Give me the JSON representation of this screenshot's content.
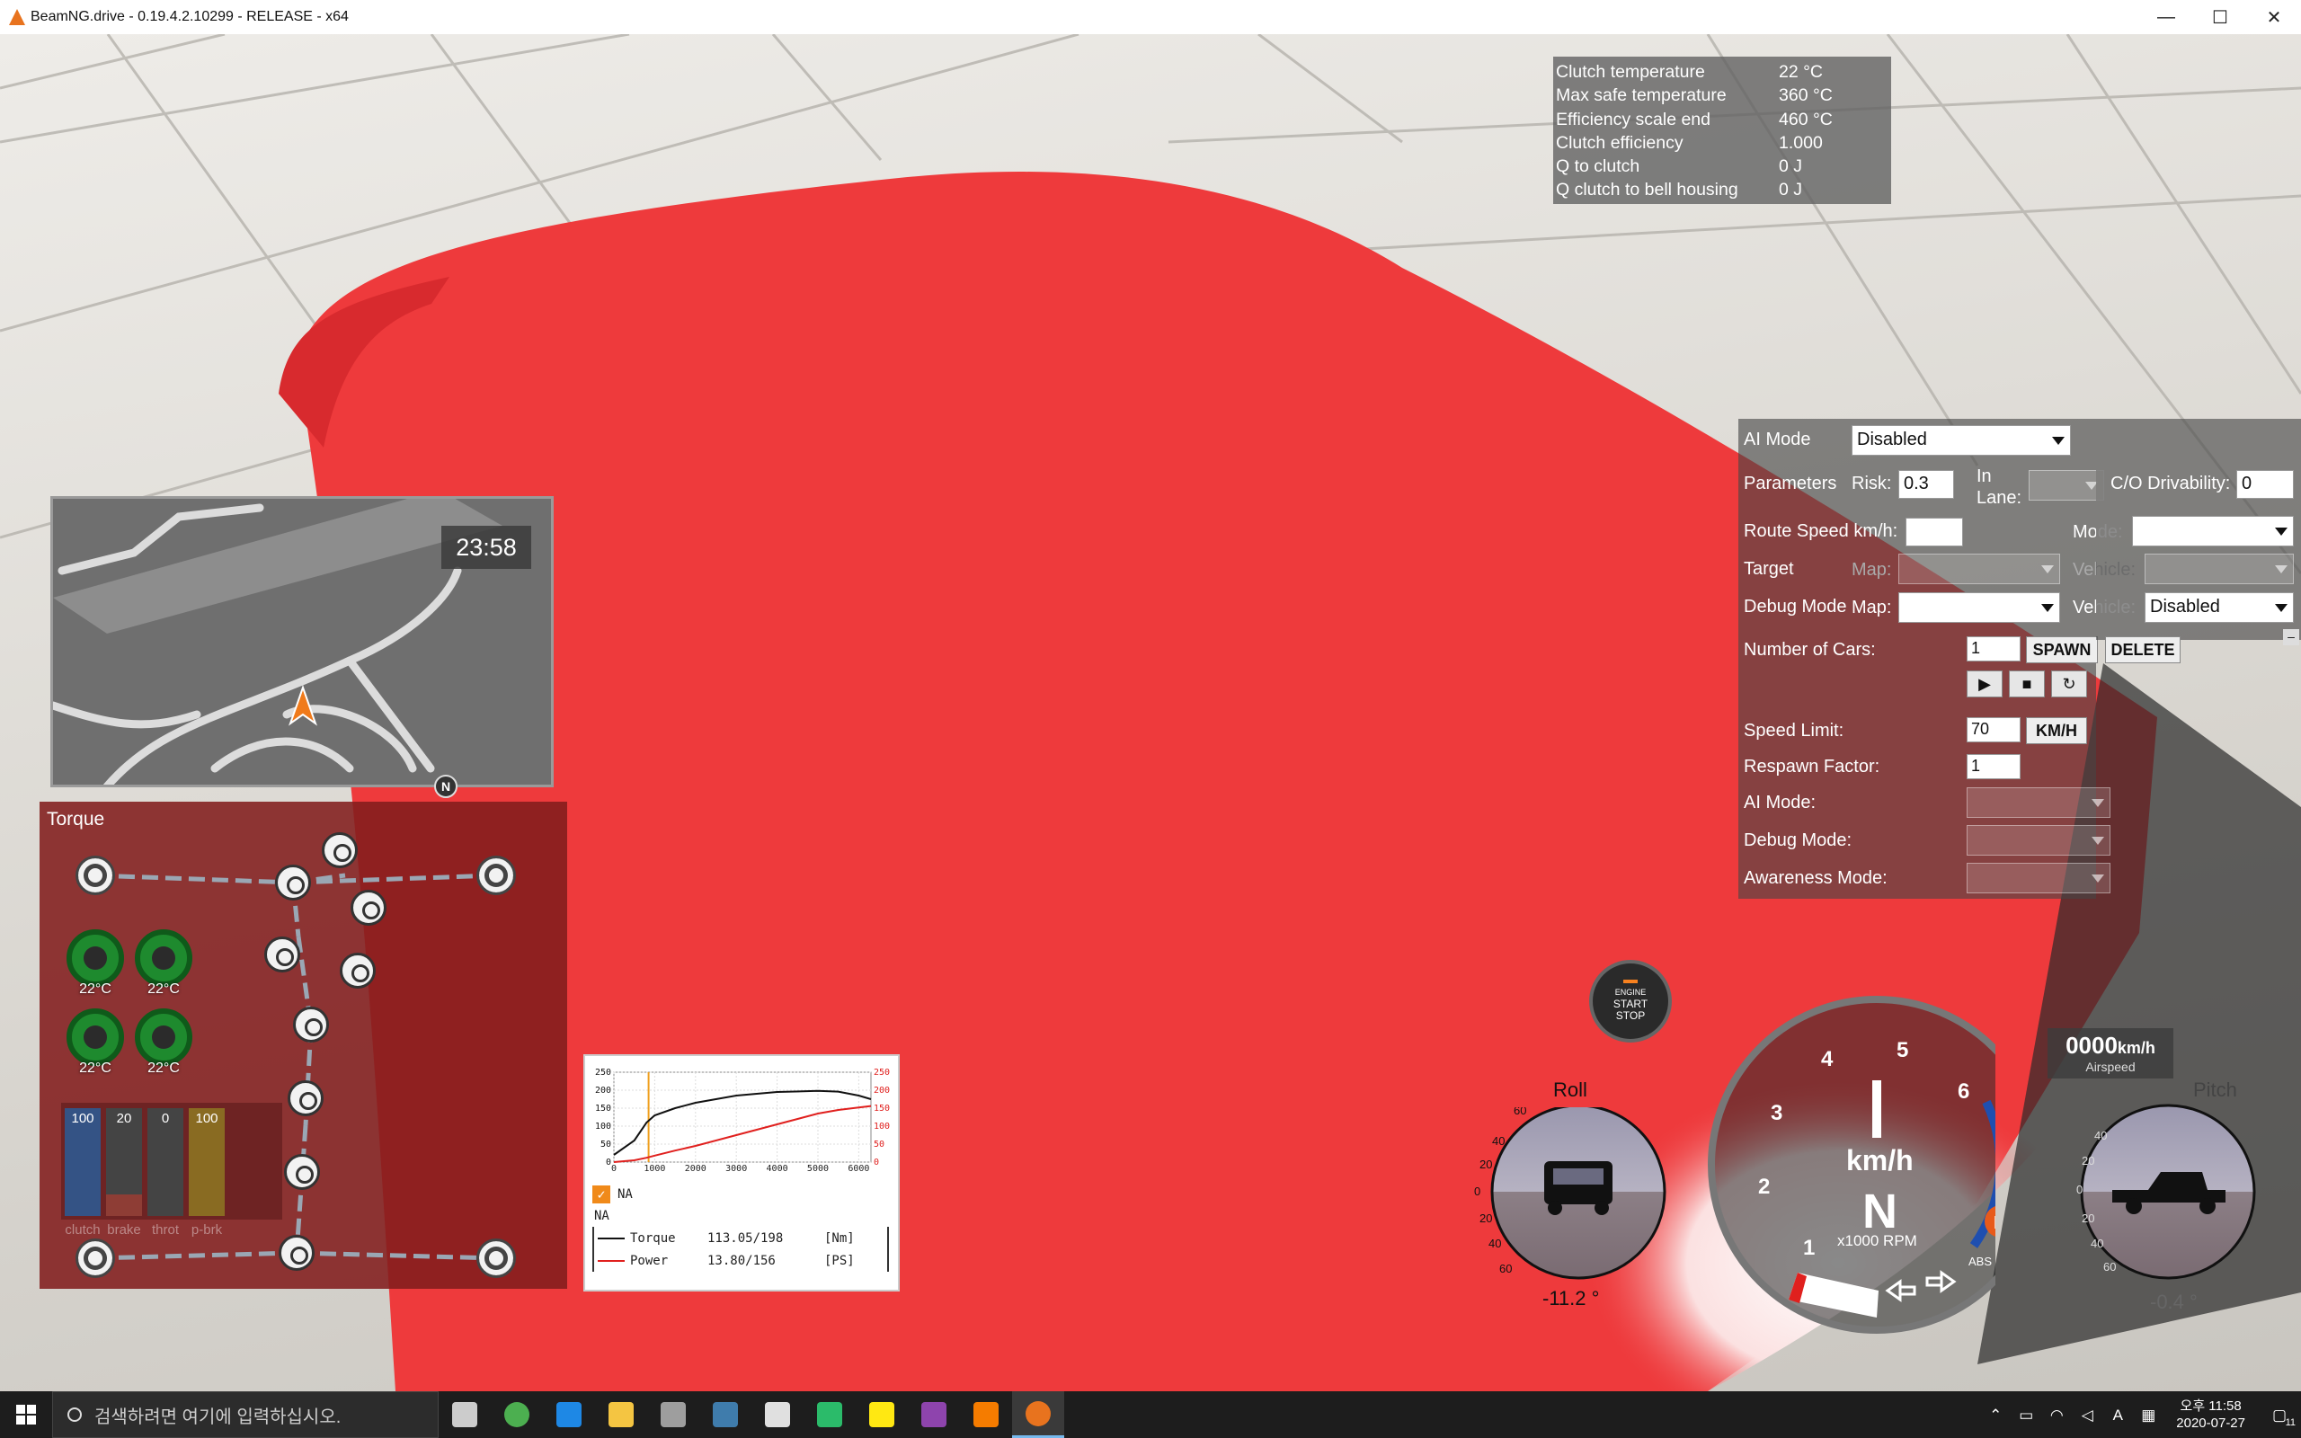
{
  "window": {
    "title": "BeamNG.drive - 0.19.4.2.10299 - RELEASE - x64",
    "minimize": "—",
    "maximize": "☐",
    "close": "✕"
  },
  "clutch_info": [
    {
      "label": "Clutch temperature",
      "value": "22 °C"
    },
    {
      "label": "Max safe temperature",
      "value": "360 °C"
    },
    {
      "label": "Efficiency scale end",
      "value": "460 °C"
    },
    {
      "label": "Clutch efficiency",
      "value": "1.000"
    },
    {
      "label": "Q to clutch",
      "value": "0 J"
    },
    {
      "label": "Q clutch to bell housing",
      "value": "0 J"
    }
  ],
  "minimap": {
    "time": "23:58",
    "compass": "N"
  },
  "torque_panel": {
    "title": "Torque",
    "brake_temps": [
      "22°C",
      "22°C",
      "22°C",
      "22°C"
    ],
    "inputs": [
      {
        "label": "clutch",
        "value": "100",
        "level": 1.0,
        "color": "#2a5db0"
      },
      {
        "label": "brake",
        "value": "20",
        "level": 0.2,
        "color": "#c0392b"
      },
      {
        "label": "throt",
        "value": "0",
        "level": 0.0,
        "color": "#27ae60"
      },
      {
        "label": "p-brk",
        "value": "100",
        "level": 1.0,
        "color": "#b8860b"
      }
    ]
  },
  "torque_graph": {
    "legend_title": "NA",
    "group_label": "NA",
    "checkbox": "✓",
    "torque_label": "Torque",
    "torque_value": "113.05/198",
    "torque_unit": "[Nm]",
    "power_label": "Power",
    "power_value": "13.80/156",
    "power_unit": "[PS]"
  },
  "chart_data": {
    "type": "line",
    "x_ticks": [
      "0",
      "1000",
      "2000",
      "3000",
      "4000",
      "5000",
      "6000"
    ],
    "y_left_ticks": [
      "250",
      "200",
      "150",
      "100",
      "50",
      "0"
    ],
    "y_right_ticks": [
      "250",
      "200",
      "150",
      "100",
      "50",
      "0"
    ],
    "xlim": [
      0,
      6300
    ],
    "ylim": [
      0,
      250
    ],
    "marker_rpm": 850,
    "series": [
      {
        "name": "Torque",
        "color": "#111111",
        "x": [
          0,
          500,
          800,
          1000,
          1500,
          2000,
          3000,
          4000,
          5000,
          5500,
          6000,
          6300
        ],
        "y": [
          20,
          60,
          110,
          130,
          150,
          165,
          185,
          195,
          198,
          196,
          185,
          175
        ]
      },
      {
        "name": "Power",
        "color": "#e0201e",
        "x": [
          0,
          500,
          800,
          1000,
          1500,
          2000,
          3000,
          4000,
          5000,
          5500,
          6000,
          6300
        ],
        "y": [
          0,
          5,
          12,
          18,
          32,
          45,
          75,
          105,
          135,
          145,
          152,
          156
        ]
      }
    ]
  },
  "ai_panel": {
    "ai_mode_label": "AI Mode",
    "ai_mode_value": "Disabled",
    "parameters_label": "Parameters",
    "risk_label": "Risk:",
    "risk_value": "0.3",
    "in_lane_label": "In Lane:",
    "in_lane_value": "",
    "co_drivability_label": "C/O Drivability:",
    "co_drivability_value": "0",
    "route_speed_label": "Route Speed km/h:",
    "route_speed_value": "",
    "mode_label": "Mode:",
    "mode_value": "",
    "target_label": "Target",
    "target_map_label": "Map:",
    "target_vehicle_label": "Vehicle:",
    "debug_mode_label": "Debug Mode",
    "debug_map_label": "Map:",
    "debug_vehicle_label": "Vehicle:",
    "debug_vehicle_value": "Disabled",
    "number_of_cars_label": "Number of Cars:",
    "number_of_cars_value": "1",
    "spawn_label": "SPAWN",
    "delete_label": "DELETE",
    "play_icon": "▶",
    "stop_icon": "■",
    "reset_icon": "↻",
    "speed_limit_label": "Speed Limit:",
    "speed_limit_value": "70",
    "unit_label": "KM/H",
    "respawn_label": "Respawn Factor:",
    "respawn_value": "1",
    "traffic_ai_mode_label": "AI Mode:",
    "traffic_debug_mode_label": "Debug Mode:",
    "awareness_mode_label": "Awareness Mode:",
    "collapse_icon": "–"
  },
  "startstop": {
    "line1": "ENGINE",
    "line2": "START",
    "line3": "STOP"
  },
  "roll_gauge": {
    "label": "Roll",
    "value": "-11.2 °",
    "ticks": [
      "60",
      "40",
      "20",
      "0",
      "20",
      "40",
      "60"
    ]
  },
  "pitch_gauge": {
    "label": "Pitch",
    "value": "-0.4 °",
    "ticks": [
      "60",
      "40",
      "20",
      "0",
      "20",
      "40",
      "60"
    ]
  },
  "speedo": {
    "gear": "N",
    "unit": "km/h",
    "rpm_label": "x1000 RPM",
    "rpm_ticks": [
      "1",
      "2",
      "3",
      "4",
      "5",
      "6"
    ],
    "park_badge": "P",
    "abs_badge": "ABS"
  },
  "airspeed": {
    "value": "0000",
    "unit": "km/h",
    "label": "Airspeed"
  },
  "taskbar": {
    "search_placeholder": "검색하려면 여기에 입력하십시오.",
    "apps": [
      "task-view",
      "chrome",
      "edge",
      "file-explorer",
      "drive",
      "python",
      "notepad",
      "maps",
      "kakaotalk",
      "winrar",
      "blender",
      "beamng"
    ],
    "app_colors": [
      "#cccccc",
      "#4caf50",
      "#1e88e5",
      "#f4c542",
      "#9e9e9e",
      "#3f7cac",
      "#e0e0e0",
      "#2bbb6a",
      "#ffe812",
      "#8e44ad",
      "#f57c00",
      "#e8731e"
    ],
    "time": "오후 11:58",
    "date": "2020-07-27",
    "ime": "A",
    "notif": "11"
  }
}
